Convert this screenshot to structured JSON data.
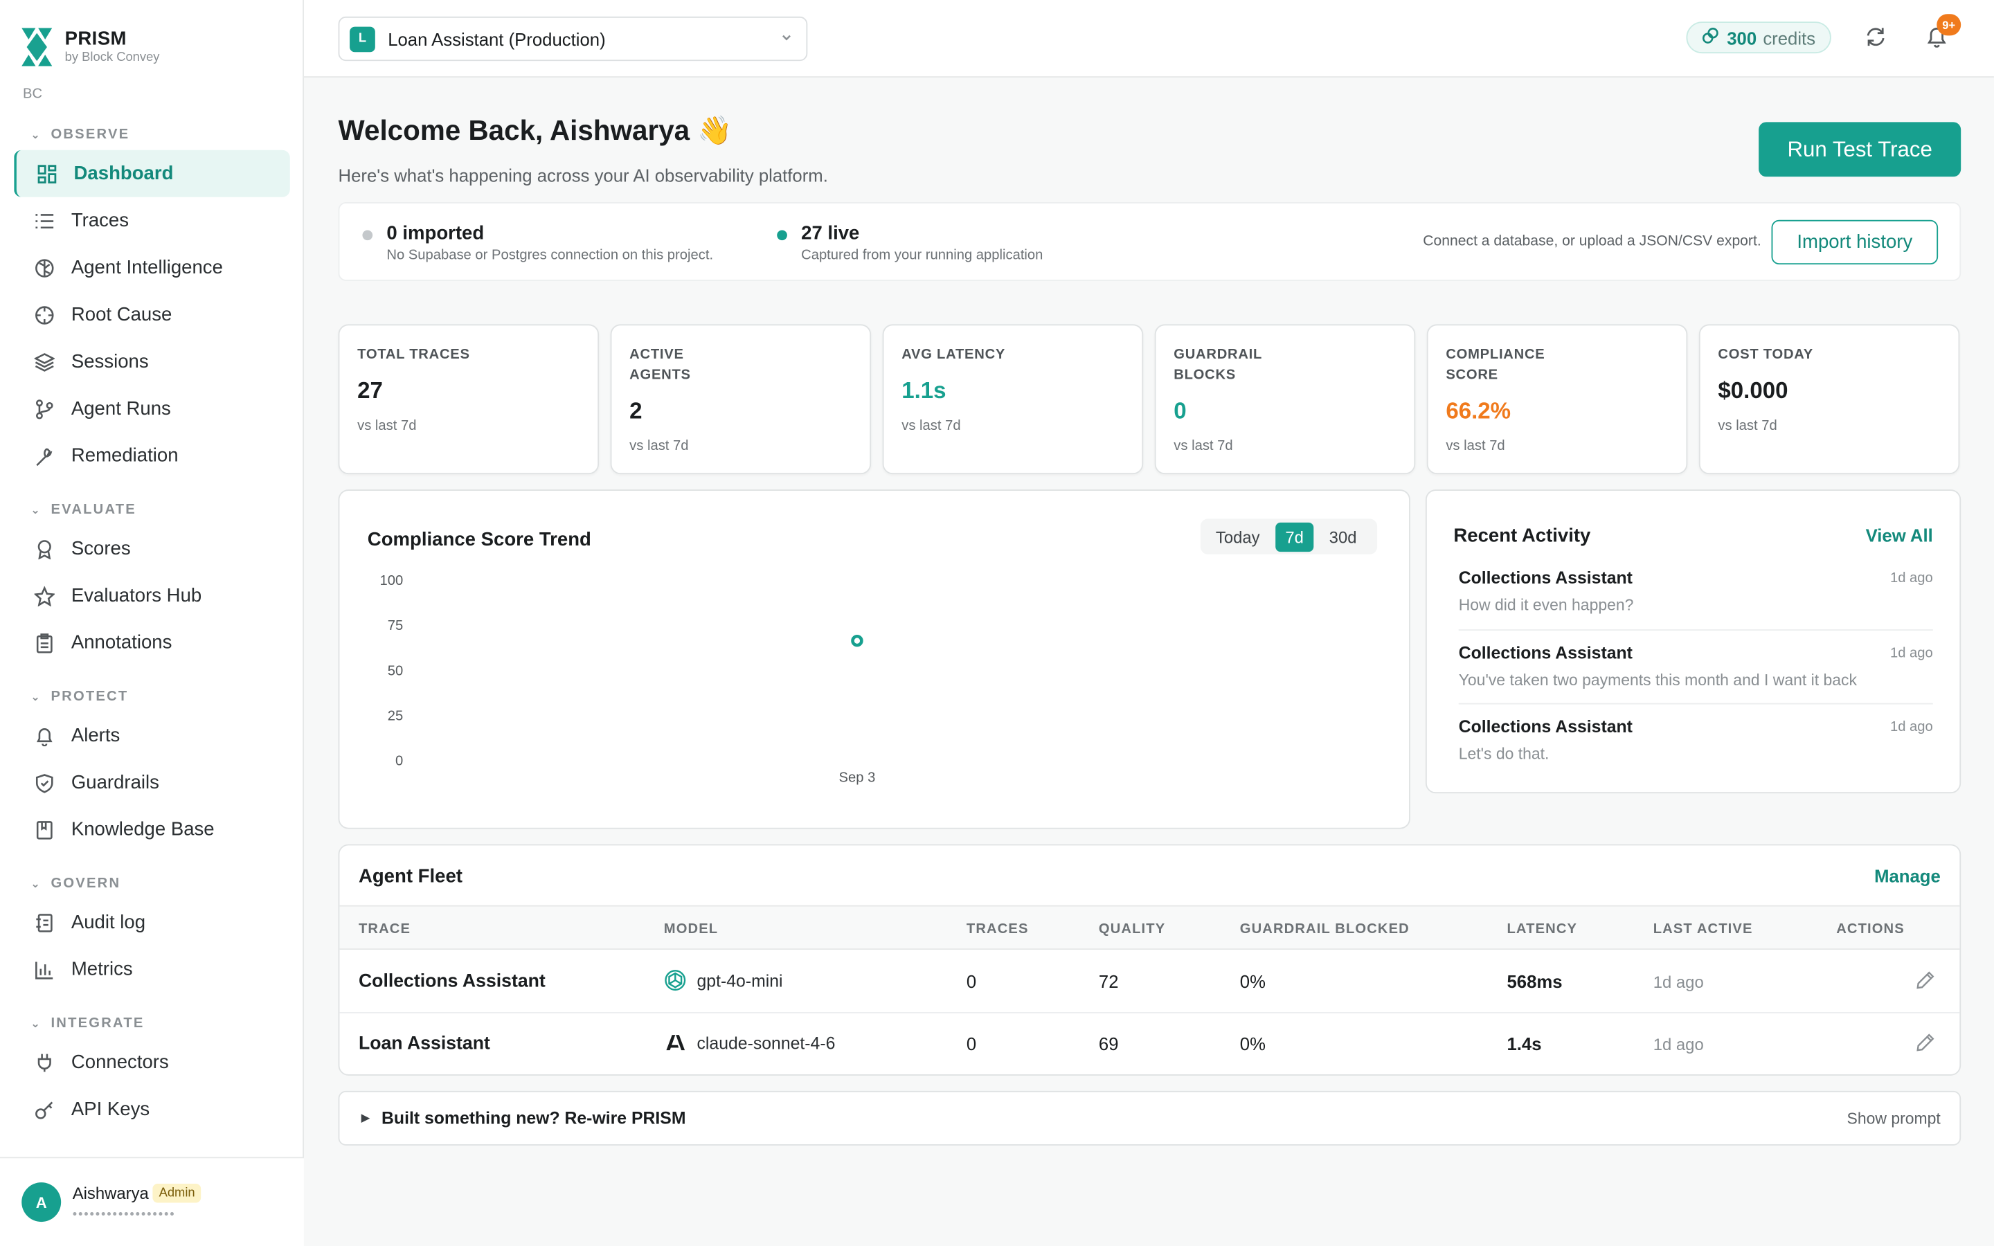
{
  "brand": {
    "name": "PRISM",
    "subtitle": "by Block Convey",
    "org": "BC"
  },
  "sidebar": {
    "sections": [
      {
        "title": "OBSERVE",
        "items": [
          {
            "label": "Dashboard",
            "icon": "dashboard-icon",
            "active": true
          },
          {
            "label": "Traces",
            "icon": "list-icon"
          },
          {
            "label": "Agent Intelligence",
            "icon": "brain-icon"
          },
          {
            "label": "Root Cause",
            "icon": "crosshair-icon"
          },
          {
            "label": "Sessions",
            "icon": "layers-icon"
          },
          {
            "label": "Agent Runs",
            "icon": "git-branch-icon"
          },
          {
            "label": "Remediation",
            "icon": "wrench-icon"
          }
        ]
      },
      {
        "title": "EVALUATE",
        "items": [
          {
            "label": "Scores",
            "icon": "award-icon"
          },
          {
            "label": "Evaluators Hub",
            "icon": "star-icon"
          },
          {
            "label": "Annotations",
            "icon": "clipboard-icon"
          }
        ]
      },
      {
        "title": "PROTECT",
        "items": [
          {
            "label": "Alerts",
            "icon": "bell-icon"
          },
          {
            "label": "Guardrails",
            "icon": "shield-icon"
          },
          {
            "label": "Knowledge Base",
            "icon": "book-icon"
          }
        ]
      },
      {
        "title": "GOVERN",
        "items": [
          {
            "label": "Audit log",
            "icon": "log-icon"
          },
          {
            "label": "Metrics",
            "icon": "bar-chart-icon"
          }
        ]
      },
      {
        "title": "INTEGRATE",
        "items": [
          {
            "label": "Connectors",
            "icon": "plug-icon"
          },
          {
            "label": "API Keys",
            "icon": "key-icon"
          }
        ]
      }
    ],
    "user": {
      "initial": "A",
      "name": "Aishwarya",
      "role": "Admin",
      "email_masked": "••••••••••••••••••"
    }
  },
  "topbar": {
    "project_badge": "L",
    "project": "Loan Assistant (Production)",
    "credits_value": "300",
    "credits_label": "credits",
    "notifications": "9+"
  },
  "header": {
    "title": "Welcome Back, Aishwarya 👋",
    "subtitle": "Here's what's happening across your AI observability platform.",
    "run_button": "Run Test Trace"
  },
  "import": {
    "imported_title": "0 imported",
    "imported_sub": "No Supabase or Postgres connection on this project.",
    "live_title": "27 live",
    "live_sub": "Captured from your running application",
    "help": "Connect a database, or upload a JSON/CSV export.",
    "button": "Import history",
    "colors": {
      "imported": "#c4c8cb",
      "live": "#17a08f"
    }
  },
  "kpis": [
    {
      "label": "TOTAL TRACES",
      "value": "27",
      "sub": "vs last 7d",
      "color": "#1a1d1f"
    },
    {
      "label": "ACTIVE AGENTS",
      "value": "2",
      "sub": "vs last 7d",
      "color": "#1a1d1f"
    },
    {
      "label": "AVG LATENCY",
      "value": "1.1s",
      "sub": "vs last 7d",
      "color": "#17a08f"
    },
    {
      "label": "GUARDRAIL BLOCKS",
      "value": "0",
      "sub": "vs last 7d",
      "color": "#17a08f"
    },
    {
      "label": "COMPLIANCE SCORE",
      "value": "66.2%",
      "sub": "vs last 7d",
      "color": "#f07a1c"
    },
    {
      "label": "COST TODAY",
      "value": "$0.000",
      "sub": "vs last 7d",
      "color": "#1a1d1f"
    }
  ],
  "compliance_chart": {
    "title": "Compliance Score Trend",
    "ranges": [
      "Today",
      "7d",
      "30d"
    ],
    "selected_range": "7d"
  },
  "chart_data": {
    "type": "scatter",
    "title": "Compliance Score Trend",
    "x": [
      "Sep 3"
    ],
    "series": [
      {
        "values": [
          66.2
        ]
      }
    ],
    "yticks": [
      100,
      75,
      50,
      25,
      0
    ],
    "ylim": [
      0,
      100
    ],
    "grid": false,
    "color": "#17a08f"
  },
  "activity": {
    "title": "Recent Activity",
    "view_all": "View All",
    "items": [
      {
        "name": "Collections Assistant",
        "time": "1d ago",
        "message": "How did it even happen?"
      },
      {
        "name": "Collections Assistant",
        "time": "1d ago",
        "message": "You've taken two payments this month and I want it back"
      },
      {
        "name": "Collections Assistant",
        "time": "1d ago",
        "message": "Let's do that."
      }
    ]
  },
  "fleet": {
    "title": "Agent Fleet",
    "manage": "Manage",
    "columns": [
      "TRACE",
      "MODEL",
      "TRACES",
      "QUALITY",
      "GUARDRAIL BLOCKED",
      "LATENCY",
      "LAST ACTIVE",
      "ACTIONS"
    ],
    "rows": [
      {
        "name": "Collections Assistant",
        "model": "gpt-4o-mini",
        "model_icon": "openai-icon",
        "traces": "0",
        "quality": "72",
        "blocked": "0%",
        "latency": "568ms",
        "last_active": "1d ago"
      },
      {
        "name": "Loan Assistant",
        "model": "claude-sonnet-4-6",
        "model_icon": "anthropic-icon",
        "traces": "0",
        "quality": "69",
        "blocked": "0%",
        "latency": "1.4s",
        "last_active": "1d ago"
      }
    ]
  },
  "rewire": {
    "text": "Built something new? Re-wire PRISM",
    "action": "Show prompt"
  }
}
